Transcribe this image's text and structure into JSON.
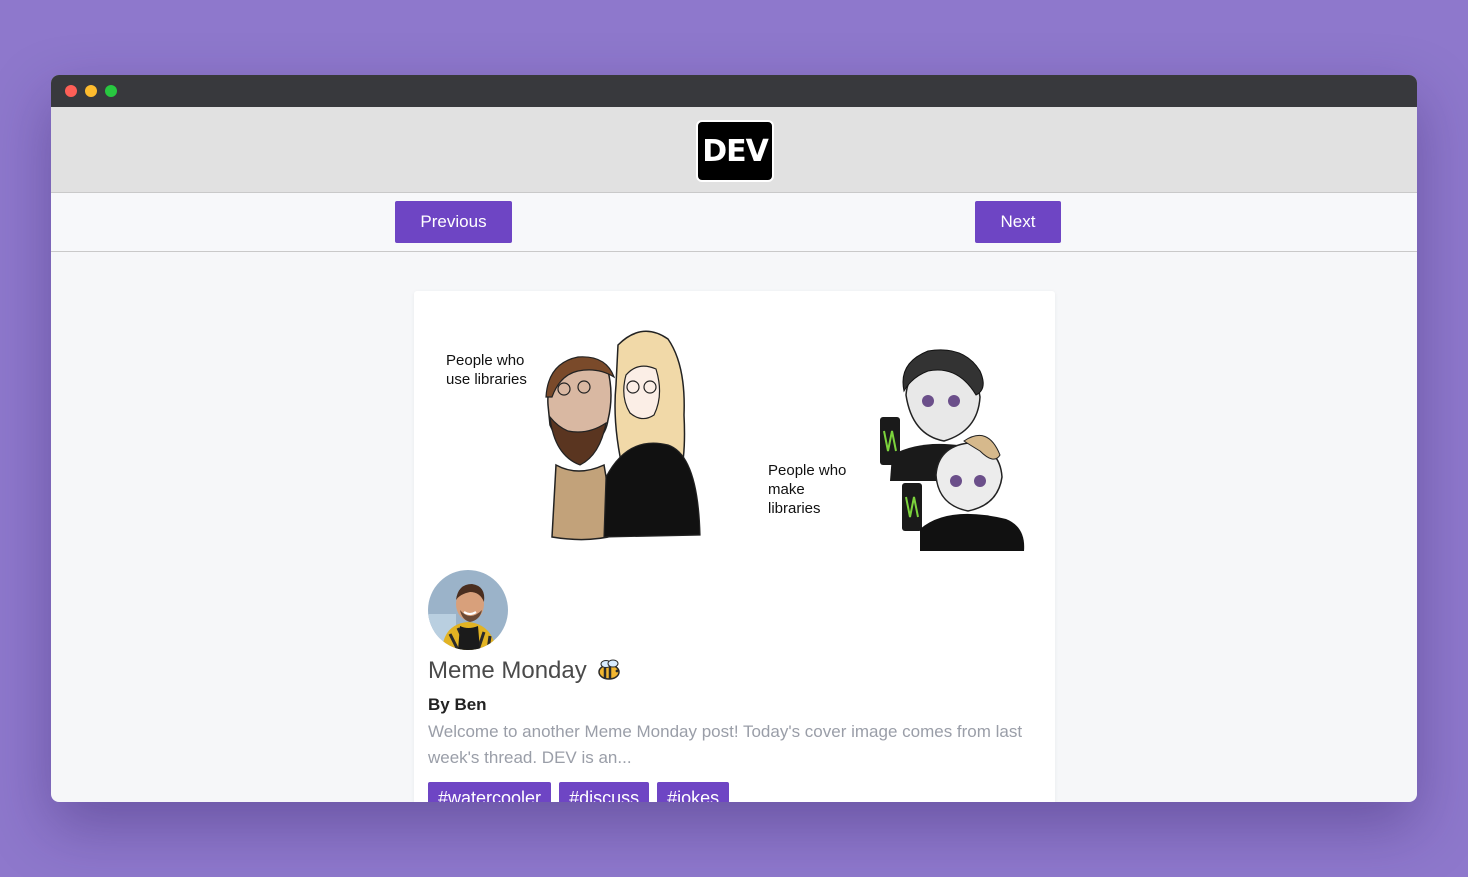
{
  "window": {
    "controls": [
      "close",
      "minimize",
      "maximize"
    ]
  },
  "header": {
    "logo_text": "DEV"
  },
  "nav": {
    "previous_label": "Previous",
    "next_label": "Next"
  },
  "article": {
    "cover": {
      "left_caption": [
        "People who",
        "use libraries"
      ],
      "right_caption": [
        "People who",
        "make",
        "libraries"
      ]
    },
    "title": "Meme Monday",
    "title_emoji_icon": "bee-icon",
    "author": "By Ben",
    "description": "Welcome to another Meme Monday post! Today's cover image comes from last week's thread. DEV is an...",
    "tags": [
      "#watercooler",
      "#discuss",
      "#jokes"
    ]
  },
  "colors": {
    "accent": "#6e45c4",
    "background": "#8e78cc"
  }
}
